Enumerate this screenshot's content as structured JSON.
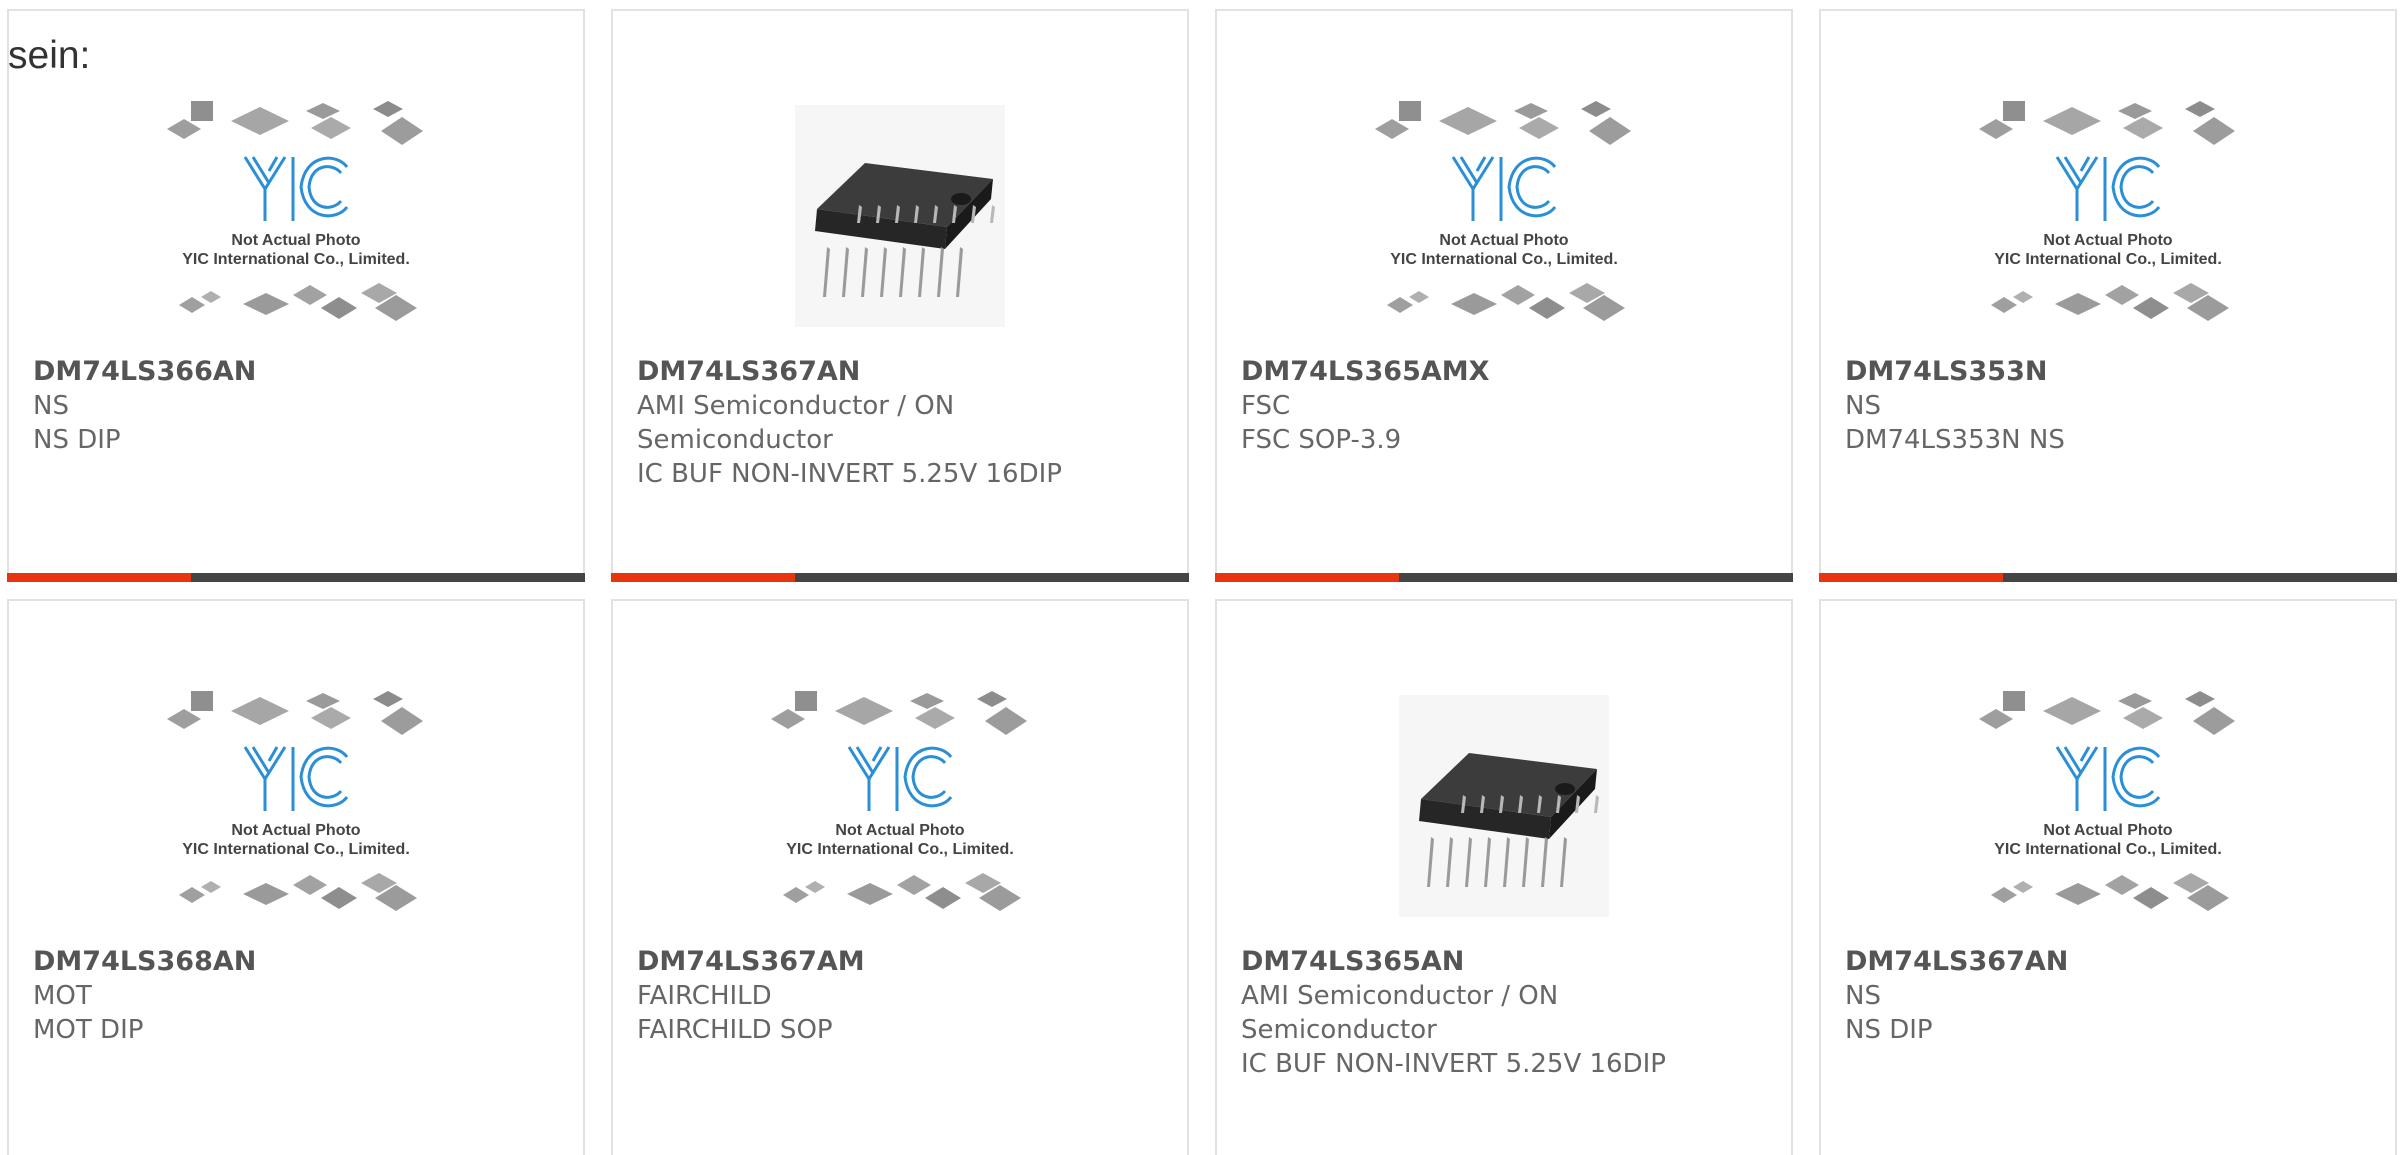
{
  "lead_text": "sein:",
  "placeholder": {
    "caption_line1": "Not Actual Photo",
    "caption_line2": "YIC International Co., Limited.",
    "logo_text": "YIC",
    "logo_color": "#2a8fd6"
  },
  "accent_colors": {
    "red": "#e8350f",
    "dark": "#444444"
  },
  "products": [
    {
      "part": "DM74LS366AN",
      "manufacturer": "NS",
      "description": "NS DIP",
      "image": "yic-placeholder"
    },
    {
      "part": "DM74LS367AN",
      "manufacturer": "AMI Semiconductor / ON Semiconductor",
      "description": "IC BUF NON-INVERT 5.25V 16DIP",
      "image": "dip16-chip"
    },
    {
      "part": "DM74LS365AMX",
      "manufacturer": "FSC",
      "description": "FSC SOP-3.9",
      "image": "yic-placeholder"
    },
    {
      "part": "DM74LS353N",
      "manufacturer": "NS",
      "description": "DM74LS353N NS",
      "image": "yic-placeholder"
    },
    {
      "part": "DM74LS368AN",
      "manufacturer": "MOT",
      "description": "MOT DIP",
      "image": "yic-placeholder"
    },
    {
      "part": "DM74LS367AM",
      "manufacturer": "FAIRCHILD",
      "description": "FAIRCHILD SOP",
      "image": "yic-placeholder"
    },
    {
      "part": "DM74LS365AN",
      "manufacturer": "AMI Semiconductor / ON Semiconductor",
      "description": "IC BUF NON-INVERT 5.25V 16DIP",
      "image": "dip16-chip"
    },
    {
      "part": "DM74LS367AN",
      "manufacturer": "NS",
      "description": "NS DIP",
      "image": "yic-placeholder"
    }
  ]
}
